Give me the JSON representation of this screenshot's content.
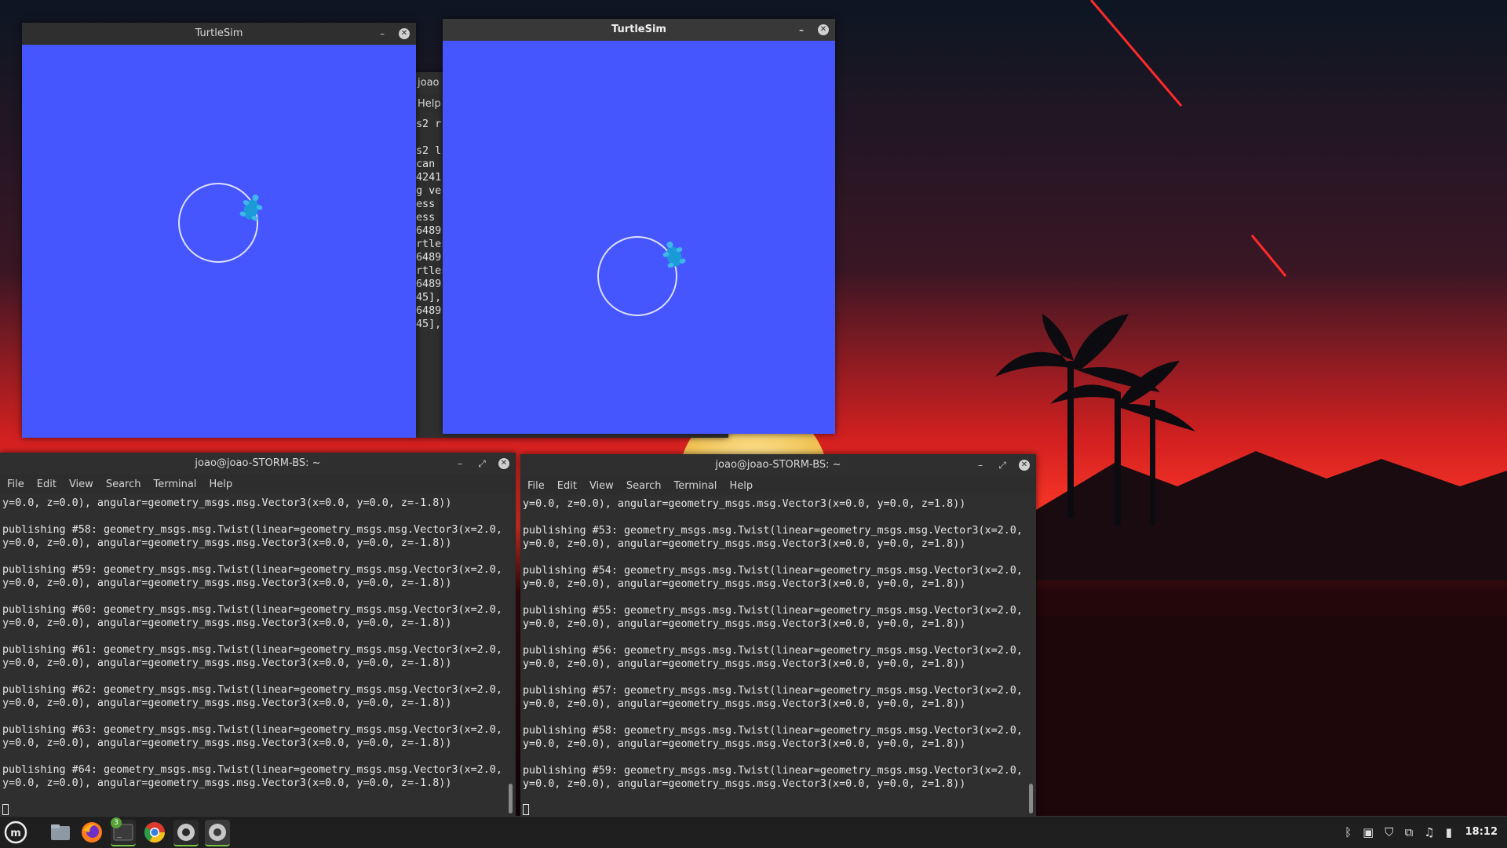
{
  "turtlesim_left": {
    "title": "TurtleSim"
  },
  "turtlesim_right": {
    "title": "TurtleSim"
  },
  "bg_terminal": {
    "title": "joao",
    "menu_help": "Help",
    "lines": [
      "s2 r",
      "",
      "s2 l",
      "can",
      "4241",
      "g ve",
      "ess",
      "ess",
      "6489",
      "rtles",
      "6489",
      "rtles",
      "6489",
      "45],",
      "6489",
      "45],"
    ]
  },
  "terminal_left": {
    "title": "joao@joao-STORM-BS: ~",
    "menu": [
      "File",
      "Edit",
      "View",
      "Search",
      "Terminal",
      "Help"
    ],
    "lines": [
      "y=0.0, z=0.0), angular=geometry_msgs.msg.Vector3(x=0.0, y=0.0, z=-1.8))",
      "",
      "publishing #58: geometry_msgs.msg.Twist(linear=geometry_msgs.msg.Vector3(x=2.0,",
      "y=0.0, z=0.0), angular=geometry_msgs.msg.Vector3(x=0.0, y=0.0, z=-1.8))",
      "",
      "publishing #59: geometry_msgs.msg.Twist(linear=geometry_msgs.msg.Vector3(x=2.0,",
      "y=0.0, z=0.0), angular=geometry_msgs.msg.Vector3(x=0.0, y=0.0, z=-1.8))",
      "",
      "publishing #60: geometry_msgs.msg.Twist(linear=geometry_msgs.msg.Vector3(x=2.0,",
      "y=0.0, z=0.0), angular=geometry_msgs.msg.Vector3(x=0.0, y=0.0, z=-1.8))",
      "",
      "publishing #61: geometry_msgs.msg.Twist(linear=geometry_msgs.msg.Vector3(x=2.0,",
      "y=0.0, z=0.0), angular=geometry_msgs.msg.Vector3(x=0.0, y=0.0, z=-1.8))",
      "",
      "publishing #62: geometry_msgs.msg.Twist(linear=geometry_msgs.msg.Vector3(x=2.0,",
      "y=0.0, z=0.0), angular=geometry_msgs.msg.Vector3(x=0.0, y=0.0, z=-1.8))",
      "",
      "publishing #63: geometry_msgs.msg.Twist(linear=geometry_msgs.msg.Vector3(x=2.0,",
      "y=0.0, z=0.0), angular=geometry_msgs.msg.Vector3(x=0.0, y=0.0, z=-1.8))",
      "",
      "publishing #64: geometry_msgs.msg.Twist(linear=geometry_msgs.msg.Vector3(x=2.0,",
      "y=0.0, z=0.0), angular=geometry_msgs.msg.Vector3(x=0.0, y=0.0, z=-1.8))"
    ]
  },
  "terminal_right": {
    "title": "joao@joao-STORM-BS: ~",
    "menu": [
      "File",
      "Edit",
      "View",
      "Search",
      "Terminal",
      "Help"
    ],
    "lines": [
      "y=0.0, z=0.0), angular=geometry_msgs.msg.Vector3(x=0.0, y=0.0, z=1.8))",
      "",
      "publishing #53: geometry_msgs.msg.Twist(linear=geometry_msgs.msg.Vector3(x=2.0,",
      "y=0.0, z=0.0), angular=geometry_msgs.msg.Vector3(x=0.0, y=0.0, z=1.8))",
      "",
      "publishing #54: geometry_msgs.msg.Twist(linear=geometry_msgs.msg.Vector3(x=2.0,",
      "y=0.0, z=0.0), angular=geometry_msgs.msg.Vector3(x=0.0, y=0.0, z=1.8))",
      "",
      "publishing #55: geometry_msgs.msg.Twist(linear=geometry_msgs.msg.Vector3(x=2.0,",
      "y=0.0, z=0.0), angular=geometry_msgs.msg.Vector3(x=0.0, y=0.0, z=1.8))",
      "",
      "publishing #56: geometry_msgs.msg.Twist(linear=geometry_msgs.msg.Vector3(x=2.0,",
      "y=0.0, z=0.0), angular=geometry_msgs.msg.Vector3(x=0.0, y=0.0, z=1.8))",
      "",
      "publishing #57: geometry_msgs.msg.Twist(linear=geometry_msgs.msg.Vector3(x=2.0,",
      "y=0.0, z=0.0), angular=geometry_msgs.msg.Vector3(x=0.0, y=0.0, z=1.8))",
      "",
      "publishing #58: geometry_msgs.msg.Twist(linear=geometry_msgs.msg.Vector3(x=2.0,",
      "y=0.0, z=0.0), angular=geometry_msgs.msg.Vector3(x=0.0, y=0.0, z=1.8))",
      "",
      "publishing #59: geometry_msgs.msg.Twist(linear=geometry_msgs.msg.Vector3(x=2.0,",
      "y=0.0, z=0.0), angular=geometry_msgs.msg.Vector3(x=0.0, y=0.0, z=1.8))"
    ]
  },
  "taskbar": {
    "terminal_badge": "3",
    "clock": "18:12",
    "apps": [
      "menu-icon",
      "files-icon",
      "firefox-icon",
      "terminal-icon",
      "chrome-icon",
      "settings-icon",
      "settings-icon"
    ],
    "tray": [
      "bluetooth-icon",
      "clipboard-icon",
      "shield-icon",
      "network-icon",
      "music-icon",
      "battery-icon"
    ]
  },
  "colors": {
    "turtlesim_bg": "#4556ff",
    "terminal_bg": "#2f2f2f",
    "accent": "#ff2a2a"
  }
}
